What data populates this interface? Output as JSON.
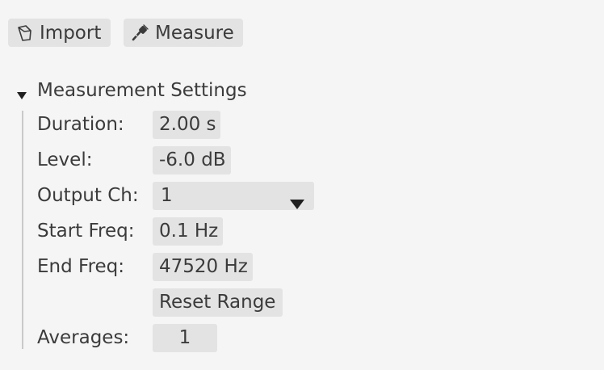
{
  "toolbar": {
    "import_label": "Import",
    "import_icon": "import-file-icon",
    "measure_label": "Measure",
    "measure_icon": "microphone-icon"
  },
  "section": {
    "title": "Measurement Settings",
    "expanded": true,
    "toggle_icon": "triangle-down-icon"
  },
  "settings": {
    "duration": {
      "label": "Duration:",
      "value": "2.00 s"
    },
    "level": {
      "label": "Level:",
      "value": "-6.0 dB"
    },
    "output_ch": {
      "label": "Output Ch:",
      "value": "1",
      "icon": "dropdown-arrow-icon"
    },
    "start_freq": {
      "label": "Start Freq:",
      "value": "0.1 Hz"
    },
    "end_freq": {
      "label": "End Freq:",
      "value": "47520 Hz"
    },
    "reset_range_label": "Reset Range",
    "averages": {
      "label": "Averages:",
      "value": "1"
    }
  },
  "colors": {
    "background": "#f5f5f5",
    "control_fill": "#e3e3e3",
    "text": "#3b3b3b",
    "guide_line": "#c9c9c9"
  }
}
